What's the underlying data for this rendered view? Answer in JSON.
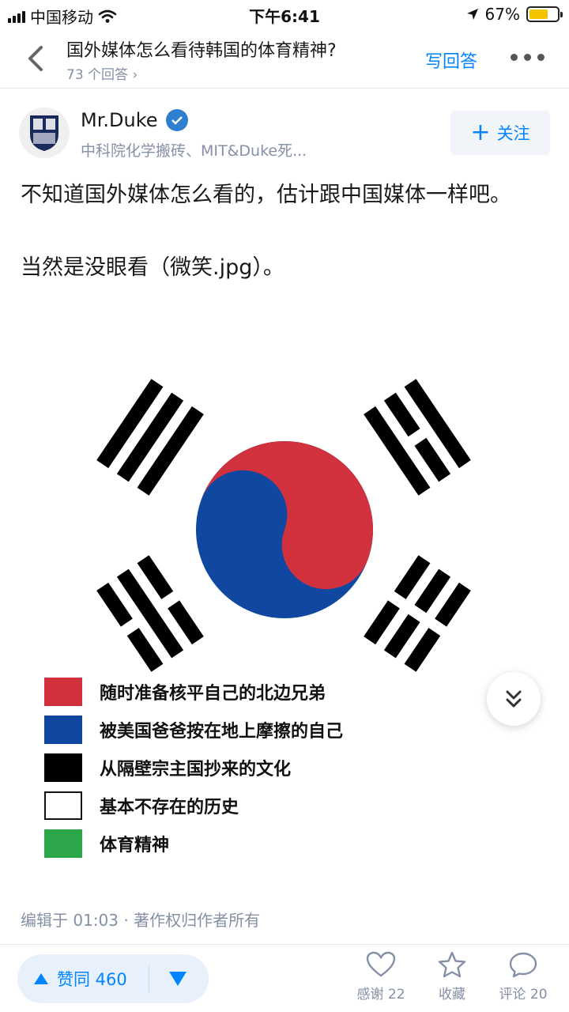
{
  "status_bar": {
    "carrier": "中国移动",
    "time": "下午6:41",
    "battery": "67%",
    "battery_level": 0.67
  },
  "nav": {
    "title": "国外媒体怎么看待韩国的体育精神?",
    "answer_count": "73 个回答",
    "write_answer": "写回答"
  },
  "author": {
    "name": "Mr.Duke",
    "description": "中科院化学搬砖、MIT&Duke死...",
    "follow_label": "关注"
  },
  "answer": {
    "paragraph1": "不知道国外媒体怎么看的，估计跟中国媒体一样吧。",
    "paragraph2": "当然是没眼看（微笑.jpg）。"
  },
  "image": {
    "legend": [
      {
        "label": "随时准备核平自己的北边兄弟",
        "color": "#d0313d"
      },
      {
        "label": "被美国爸爸按在地上摩擦的自己",
        "color": "#0f47a1"
      },
      {
        "label": "从隔壁宗主国抄来的文化",
        "color": "#000000"
      },
      {
        "label": "基本不存在的历史",
        "color": "#ffffff"
      },
      {
        "label": "体育精神",
        "color": "#2ca84a"
      }
    ]
  },
  "meta": "编辑于 01:03 · 著作权归作者所有",
  "bottom_bar": {
    "vote_label": "赞同 460",
    "thanks_label": "感谢 22",
    "collect_label": "收藏",
    "comment_label": "评论 20"
  },
  "colors": {
    "accent": "#0084ff",
    "muted": "#8590a6"
  }
}
